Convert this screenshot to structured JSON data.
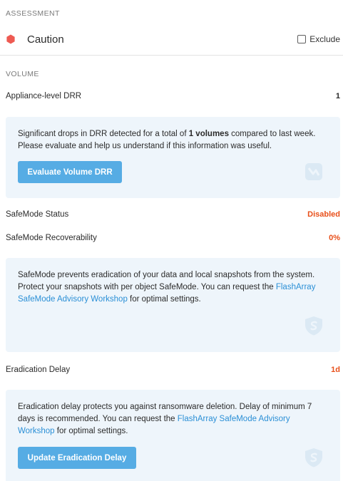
{
  "assessment": {
    "section_title": "ASSESSMENT",
    "status_label": "Caution",
    "status_color": "#ee5a52",
    "exclude_label": "Exclude",
    "exclude_checked": false
  },
  "volume": {
    "section_title": "VOLUME",
    "drr": {
      "label": "Appliance-level DRR",
      "value": "1"
    },
    "drr_card": {
      "text_before": "Significant drops in DRR detected for a total of ",
      "text_bold": "1 volumes",
      "text_after": " compared to last week. Please evaluate and help us understand if this information was useful.",
      "button_label": "Evaluate Volume DRR"
    },
    "safemode_status": {
      "label": "SafeMode Status",
      "value": "Disabled"
    },
    "safemode_recoverability": {
      "label": "SafeMode Recoverability",
      "value": "0%"
    },
    "safemode_card": {
      "text_before": "SafeMode prevents eradication of your data and local snapshots from the system. Protect your snapshots with per object SafeMode. You can request the ",
      "link_text": "FlashArray SafeMode Advisory Workshop",
      "text_after": " for optimal settings."
    },
    "eradication_delay": {
      "label": "Eradication Delay",
      "value": "1d"
    },
    "eradication_card": {
      "text_before": "Eradication delay protects you against ransomware deletion. Delay of minimum 7 days is recommended. You can request the ",
      "link_text": "FlashArray SafeMode Advisory Workshop",
      "text_after": " for optimal settings.",
      "button_label": "Update Eradication Delay"
    }
  },
  "colors": {
    "accent_red": "#e8501b",
    "button_blue": "#56ace4",
    "link_blue": "#2a8fd6",
    "card_bg": "#eef5fb"
  }
}
